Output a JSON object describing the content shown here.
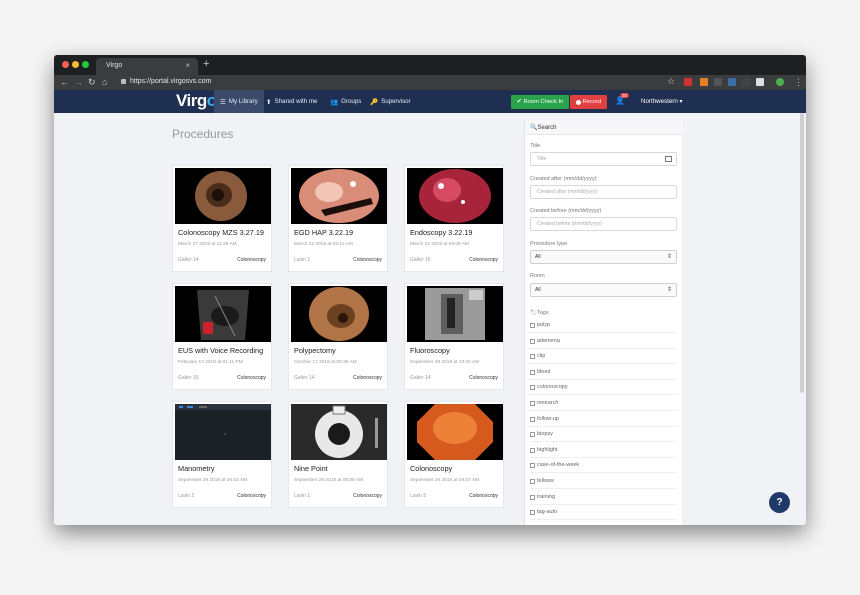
{
  "browser": {
    "tab_title": "Virgo",
    "tab_close": "×",
    "new_tab": "+",
    "url": "https://portal.virgosvs.com",
    "nav_icons": [
      "back-arrow-icon",
      "forward-arrow-icon",
      "reload-icon",
      "home-icon"
    ]
  },
  "app": {
    "logo_prefix": "Virg",
    "logo_suffix": "o",
    "nav": [
      {
        "label": "My Library",
        "icon": "list-icon"
      },
      {
        "label": "Shared with me",
        "icon": "share-icon"
      },
      {
        "label": "Groups",
        "icon": "users-icon"
      },
      {
        "label": "Supervisor",
        "icon": "key-icon"
      }
    ],
    "checkin_label": "Room Check In",
    "record_label": "Record",
    "notification_count": "30",
    "org_label": "Northwestern ▾",
    "brand_color": "#1f2f52",
    "checkin_color": "#2aa34a",
    "record_color": "#e0403f"
  },
  "page": {
    "title": "Procedures"
  },
  "procedures": [
    {
      "title": "Colonoscopy MZS 3.27.19",
      "date": "March 27 2019 at 11:28 AM",
      "room": "Galter 14",
      "type": "Colonoscopy",
      "thumb": "colon"
    },
    {
      "title": "EGD HAP 3.22.19",
      "date": "March 22 2019 at 09:12 AM",
      "room": "Lavin 1",
      "type": "Colonoscopy",
      "thumb": "egd"
    },
    {
      "title": "Endoscopy 3.22.19",
      "date": "March 22 2019 at 09:08 AM",
      "room": "Galter 15",
      "type": "Colonoscopy",
      "thumb": "endo"
    },
    {
      "title": "EUS with Voice Recording",
      "date": "February 12 2019 at 01:11 PM",
      "room": "Galter 15",
      "type": "Colonoscopy",
      "thumb": "eus"
    },
    {
      "title": "Polypectomy",
      "date": "October 17 2018 at 06:36 AM",
      "room": "Galter 14",
      "type": "Colonoscopy",
      "thumb": "polyp"
    },
    {
      "title": "Fluoroscopy",
      "date": "September 28 2018 at 10:25 AM",
      "room": "Galter 14",
      "type": "Colonoscopy",
      "thumb": "fluoro"
    },
    {
      "title": "Manometry",
      "date": "September 28 2018 at 06:15 AM",
      "room": "Lavin 2",
      "type": "Colonoscopy",
      "thumb": "mano"
    },
    {
      "title": "Nine Point",
      "date": "September 28 2018 at 06:05 AM",
      "room": "Lavin 1",
      "type": "Colonoscopy",
      "thumb": "nine"
    },
    {
      "title": "Colonoscopy",
      "date": "September 26 2018 at 08:57 AM",
      "room": "Lavin 5",
      "type": "Colonoscopy",
      "thumb": "orange"
    }
  ],
  "search": {
    "header": "Search",
    "title_label": "Title",
    "title_placeholder": "Title",
    "after_label": "Created after (mm/dd/yyyy)",
    "after_placeholder": "Created after (mm/dd/yyyy)",
    "before_label": "Created before (mm/dd/yyyy)",
    "before_placeholder": "Created before (mm/dd/yyyy)",
    "type_label": "Procedure type",
    "type_value": "All",
    "room_label": "Room",
    "room_value": "All",
    "tags_label": "Tags",
    "tags": [
      "polyp",
      "adenoma",
      "clip",
      "bleed",
      "colonoscopy",
      "research",
      "follow-up",
      "biopsy",
      "highlight",
      "case-of-the-week",
      "fellows",
      "training",
      "tag-auto"
    ]
  },
  "help_label": "?"
}
